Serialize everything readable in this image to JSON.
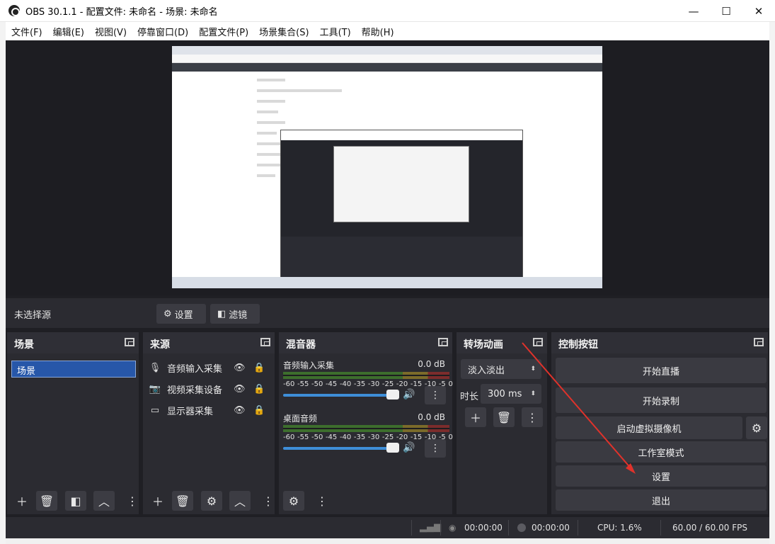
{
  "window": {
    "title": "OBS 30.1.1 - 配置文件: 未命名 - 场景: 未命名",
    "minimize": "—",
    "maximize": "☐",
    "close": "✕"
  },
  "menu": [
    "文件(F)",
    "编辑(E)",
    "视图(V)",
    "停靠窗口(D)",
    "配置文件(P)",
    "场景集合(S)",
    "工具(T)",
    "帮助(H)"
  ],
  "source_toolbar": {
    "no_source": "未选择源",
    "settings": "设置",
    "filters": "滤镜"
  },
  "scenes": {
    "title": "场景",
    "items": [
      "场景"
    ]
  },
  "sources": {
    "title": "来源",
    "items": [
      {
        "label": "音频输入采集",
        "icon": "microphone-icon"
      },
      {
        "label": "视频采集设备",
        "icon": "camera-icon"
      },
      {
        "label": "显示器采集",
        "icon": "monitor-icon"
      }
    ]
  },
  "mixer": {
    "title": "混音器",
    "scale": [
      "-60",
      "-55",
      "-50",
      "-45",
      "-40",
      "-35",
      "-30",
      "-25",
      "-20",
      "-15",
      "-10",
      "-5",
      "0"
    ],
    "channels": [
      {
        "name": "音频输入采集",
        "db": "0.0 dB"
      },
      {
        "name": "桌面音频",
        "db": "0.0 dB"
      }
    ]
  },
  "transitions": {
    "title": "转场动画",
    "selected": "淡入淡出",
    "duration_label": "时长",
    "duration_value": "300 ms"
  },
  "controls": {
    "title": "控制按钮",
    "start_stream": "开始直播",
    "start_record": "开始录制",
    "virtual_camera": "启动虚拟摄像机",
    "studio_mode": "工作室模式",
    "settings": "设置",
    "exit": "退出"
  },
  "status": {
    "stream_time": "00:00:00",
    "record_time": "00:00:00",
    "cpu": "CPU: 1.6%",
    "fps": "60.00 / 60.00 FPS"
  },
  "colors": {
    "dark_bg": "#1f1f24",
    "panel": "#2b2b31",
    "selection": "#2757a9",
    "slider": "#3e8ed8",
    "arrow": "#e0322b"
  }
}
